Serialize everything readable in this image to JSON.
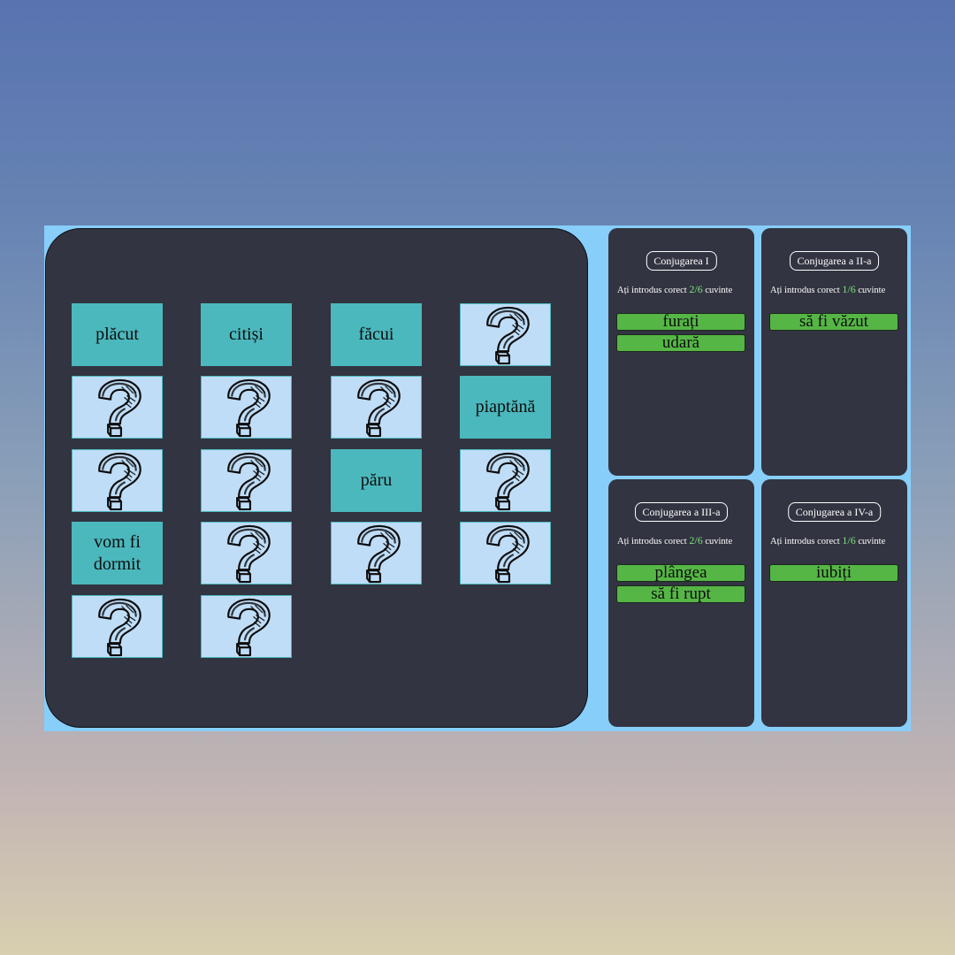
{
  "board": {
    "cards": [
      {
        "state": "revealed",
        "text": "plăcut"
      },
      {
        "state": "revealed",
        "text": "citiși"
      },
      {
        "state": "revealed",
        "text": "făcui"
      },
      {
        "state": "hidden",
        "text": ""
      },
      {
        "state": "hidden",
        "text": ""
      },
      {
        "state": "hidden",
        "text": ""
      },
      {
        "state": "hidden",
        "text": ""
      },
      {
        "state": "revealed",
        "text": "piaptănă"
      },
      {
        "state": "hidden",
        "text": ""
      },
      {
        "state": "hidden",
        "text": ""
      },
      {
        "state": "revealed",
        "text": "păru"
      },
      {
        "state": "hidden",
        "text": ""
      },
      {
        "state": "revealed",
        "text": "vom fi dormit"
      },
      {
        "state": "hidden",
        "text": ""
      },
      {
        "state": "hidden",
        "text": ""
      },
      {
        "state": "hidden",
        "text": ""
      },
      {
        "state": "hidden",
        "text": ""
      },
      {
        "state": "hidden",
        "text": ""
      }
    ],
    "hidden_icon": "question-mark-icon"
  },
  "panels": [
    {
      "title": "Conjugarea I",
      "status_prefix": "Ați introdus corect",
      "score": "2/6",
      "status_suffix": "cuvinte",
      "answers": [
        "furați",
        "udară"
      ]
    },
    {
      "title": "Conjugarea a II-a",
      "status_prefix": "Ați introdus corect",
      "score": "1/6",
      "status_suffix": "cuvinte",
      "answers": [
        "să fi văzut"
      ]
    },
    {
      "title": "Conjugarea a III-a",
      "status_prefix": "Ați introdus corect",
      "score": "2/6",
      "status_suffix": "cuvinte",
      "answers": [
        "plângea",
        "să fi rupt"
      ]
    },
    {
      "title": "Conjugarea a IV-a",
      "status_prefix": "Ați introdus corect",
      "score": "1/6",
      "status_suffix": "cuvinte",
      "answers": [
        "iubiți"
      ]
    }
  ],
  "colors": {
    "stage": "#87cefa",
    "board": "#323441",
    "card_revealed": "#4bb8bd",
    "card_hidden": "#bfddf7",
    "answer": "#55b646",
    "score": "#7ee27e"
  }
}
